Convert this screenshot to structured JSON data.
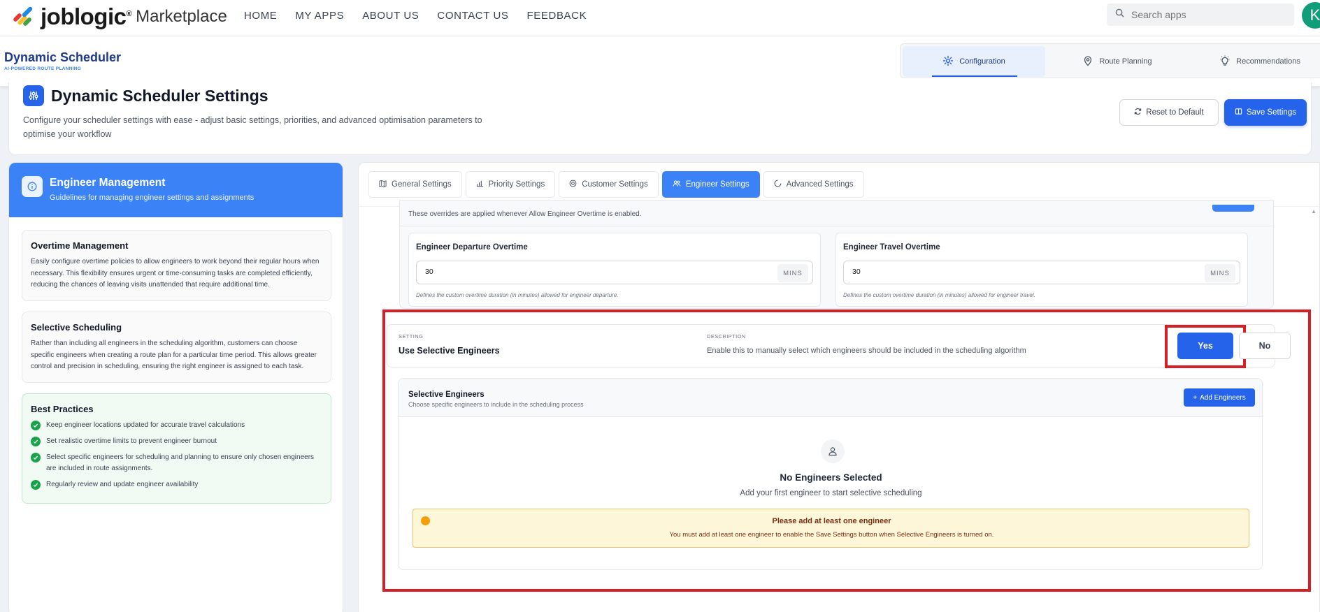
{
  "topnav": {
    "logo_word": "joblogic",
    "logo_reg": "®",
    "logo_market": "Marketplace",
    "links": [
      "HOME",
      "MY APPS",
      "ABOUT US",
      "CONTACT US",
      "FEEDBACK"
    ],
    "search_placeholder": "Search apps",
    "avatar_initial": "K"
  },
  "app": {
    "title": "Dynamic Scheduler",
    "subtitle": "AI-POWERED ROUTE PLANNING",
    "tabs": [
      {
        "label": "Configuration",
        "icon": "gear-icon",
        "active": true
      },
      {
        "label": "Route Planning",
        "icon": "map-pin-icon",
        "active": false
      },
      {
        "label": "Recommendations",
        "icon": "lightbulb-icon",
        "active": false
      }
    ]
  },
  "settings": {
    "title": "Dynamic Scheduler Settings",
    "description": "Configure your scheduler settings with ease - adjust basic settings, priorities, and advanced optimisation parameters to optimise your workflow",
    "reset_label": "Reset to Default",
    "save_label": "Save Settings"
  },
  "left": {
    "title": "Engineer Management",
    "subtitle": "Guidelines for managing engineer settings and assignments",
    "overtime": {
      "title": "Overtime Management",
      "text": "Easily configure overtime policies to allow engineers to work beyond their regular hours when necessary. This flexibility ensures urgent or time-consuming tasks are completed efficiently, reducing the chances of leaving visits unattended that require additional time."
    },
    "selective": {
      "title": "Selective Scheduling",
      "text": "Rather than including all engineers in the scheduling algorithm, customers can choose specific engineers when creating a route plan for a particular time period. This allows greater control and precision in scheduling, ensuring the right engineer is assigned to each task."
    },
    "best": {
      "title": "Best Practices",
      "items": [
        "Keep engineer locations updated for accurate travel calculations",
        "Set realistic overtime limits to prevent engineer burnout",
        "Select specific engineers for scheduling and planning to ensure only chosen engineers are included in route assignments.",
        "Regularly review and update engineer availability"
      ]
    }
  },
  "tabs": [
    "General Settings",
    "Priority Settings",
    "Customer Settings",
    "Engineer Settings",
    "Advanced Settings"
  ],
  "active_tab": "Engineer Settings",
  "overtime_section": {
    "note": "These overrides are applied whenever Allow Engineer Overtime is enabled.",
    "departure": {
      "label": "Engineer Departure Overtime",
      "value": "30",
      "unit": "MINS",
      "hint": "Defines the custom overtime duration (in minutes) allowed for engineer departure."
    },
    "travel": {
      "label": "Engineer Travel Overtime",
      "value": "30",
      "unit": "MINS",
      "hint": "Defines the custom overtime duration (in minutes) allowed for engineer travel."
    }
  },
  "selective_setting": {
    "setting_caption": "SETTING",
    "name": "Use Selective Engineers",
    "description_caption": "DESCRIPTION",
    "description": "Enable this to manually select which engineers should be included in the scheduling algorithm",
    "yes_label": "Yes",
    "no_label": "No"
  },
  "selective_engineers": {
    "title": "Selective Engineers",
    "subtitle": "Choose specific engineers to include in the scheduling process",
    "add_label": "Add Engineers",
    "empty_title": "No Engineers Selected",
    "empty_sub": "Add your first engineer to start selective scheduling",
    "warning_title": "Please add at least one engineer",
    "warning_text": "You must add at least one engineer to enable the Save Settings button when Selective Engineers is turned on."
  },
  "colors": {
    "primary": "#2563eb",
    "highlight": "#d31f26",
    "success": "#16a34a",
    "warning_bg": "#fef6d8"
  }
}
